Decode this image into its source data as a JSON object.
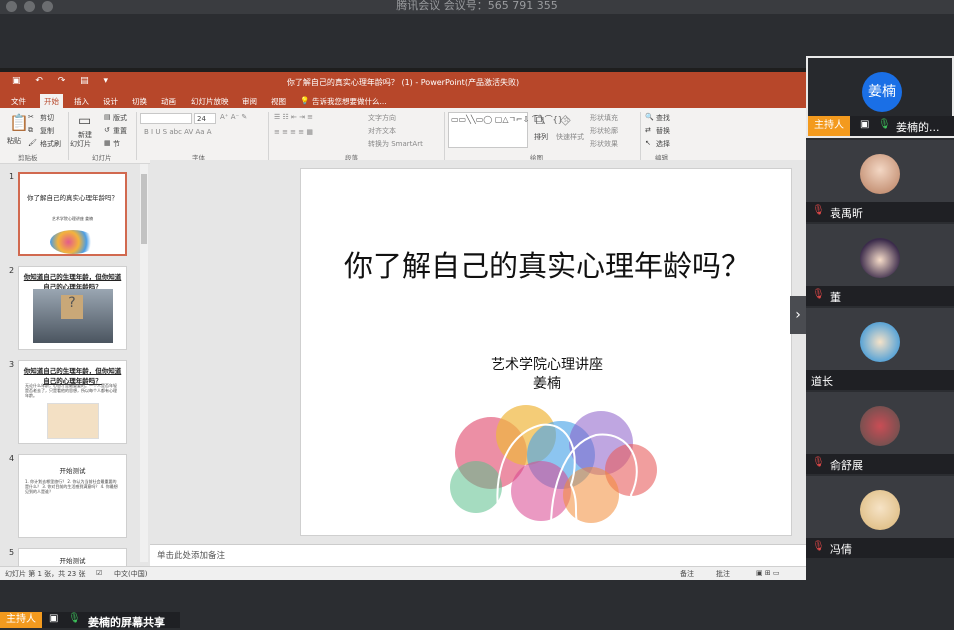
{
  "meeting": {
    "title": "腾讯会议 会议号：565 791 355"
  },
  "ppt": {
    "window_title": "你了解自己的真实心理年龄吗？ (1) - PowerPoint(产品激活失败)",
    "tabs": [
      "文件",
      "开始",
      "插入",
      "设计",
      "切换",
      "动画",
      "幻灯片放映",
      "审阅",
      "视图"
    ],
    "tell_me": "告诉我您想要做什么...",
    "ribbon": {
      "paste": "粘贴",
      "cut": "剪切",
      "copy": "复制",
      "format_painter": "格式刷",
      "new_slide": "新建",
      "new_slide2": "幻灯片",
      "layout": "版式",
      "reset": "重置",
      "section": "节",
      "font_size": "24",
      "text_direction": "文字方向",
      "align_text": "对齐文本",
      "smartart": "转换为 SmartArt",
      "arrange": "排列",
      "quick_styles": "快速样式",
      "shape_fill": "形状填充",
      "shape_outline": "形状轮廓",
      "shape_effects": "形状效果",
      "find": "查找",
      "replace": "替换",
      "select": "选择",
      "groups": [
        "剪贴板",
        "幻灯片",
        "字体",
        "段落",
        "绘图",
        "编辑"
      ]
    },
    "thumbnails": [
      {
        "num": "1",
        "title": "你了解自己的真实心理年龄吗？",
        "sub": "艺术学院心理讲座 姜楠"
      },
      {
        "num": "2",
        "title": "你知道自己的生理年龄，但你知道自己的心理年龄吗？",
        "sub": ""
      },
      {
        "num": "3",
        "title": "你知道自己的生理年龄，但你知道自己的心理年龄吗？",
        "sub": "无论什么年龄，心态才是最重要的。一个人是否年轻是否老去了，只是看他的思想，所以每个人都有心理年龄。"
      },
      {
        "num": "4",
        "title": "开始测试",
        "sub": "1. 你计划去哪里旅行？ 2. 你认为当前社会最重要的是什么？ 3. 你对目前的生活感到满意吗？ 4. 你最想见到的人是谁？"
      },
      {
        "num": "5",
        "title": "开始测试",
        "sub": ""
      }
    ],
    "slide": {
      "title": "你了解自己的真实心理年龄吗？",
      "subtitle1": "艺术学院心理讲座",
      "subtitle2": "姜楠"
    },
    "notes_placeholder": "单击此处添加备注",
    "status": {
      "slide_info": "幻灯片 第 1 张，共 23 张",
      "language": "中文(中国)",
      "notes": "备注",
      "comments": "批注"
    }
  },
  "participants": [
    {
      "name": "姜楠的...",
      "avatar_text": "姜楠",
      "role": "主持人",
      "muted": false
    },
    {
      "name": "袁禹昕",
      "muted": true
    },
    {
      "name": "董",
      "muted": true
    },
    {
      "name": "道长",
      "muted": false
    },
    {
      "name": "俞舒展",
      "muted": true
    },
    {
      "name": "冯倩",
      "muted": true
    }
  ],
  "share": {
    "host_label": "主持人",
    "sharing_text": "姜楠的屏幕共享"
  },
  "colors": {
    "ppt_red": "#b7472a",
    "host_orange": "#f39a1e",
    "avatar_blue": "#1a6fe6"
  }
}
